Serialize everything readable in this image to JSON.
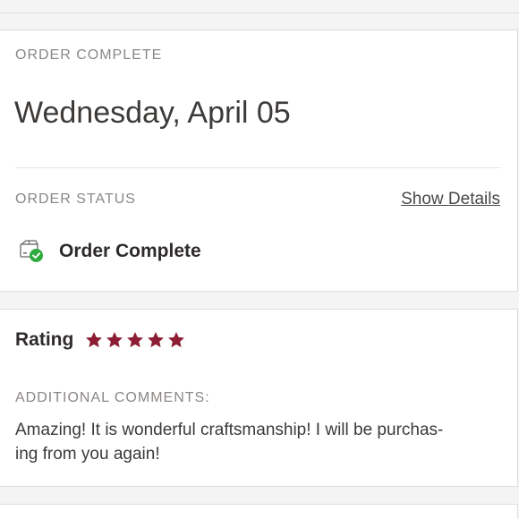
{
  "order": {
    "section_label": "ORDER COMPLETE",
    "date": "Wednesday, April 05",
    "status_label": "ORDER STATUS",
    "show_details": "Show Details",
    "status_text": "Order Complete",
    "status_icon": "package-check-icon",
    "status_icon_color": "#2eaa3f"
  },
  "rating": {
    "label": "Rating",
    "stars": 5,
    "max_stars": 5,
    "star_color": "#8c1d33",
    "comments_label": "ADDITIONAL COMMENTS:",
    "comment_line1": "Amazing! It is wonderful craftsmanship! I will be purchas-",
    "comment_line2": "ing from you again!"
  }
}
